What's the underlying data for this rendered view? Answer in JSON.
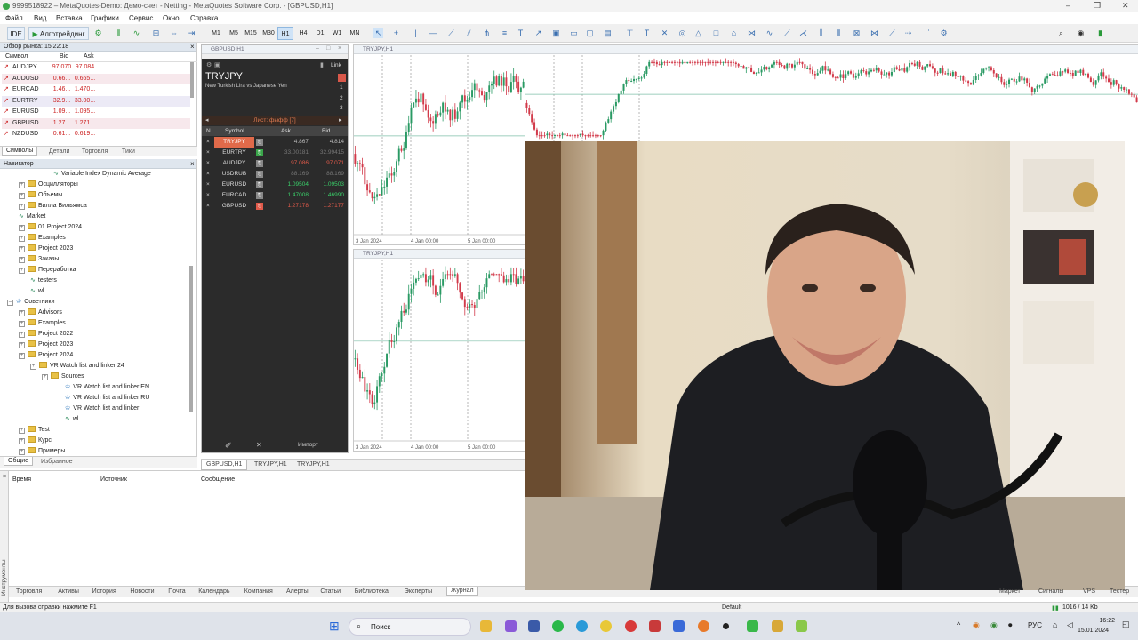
{
  "window": {
    "title": "9999518922 – MetaQuotes-Demo: Демо-счет - Netting - MetaQuotes Software Corp. - [GBPUSD,H1]"
  },
  "menu": [
    "Файл",
    "Вид",
    "Вставка",
    "Графики",
    "Сервис",
    "Окно",
    "Справка"
  ],
  "toolbar": {
    "ide": "IDE",
    "algo": "Алготрейдинг",
    "timeframes": [
      "M1",
      "M5",
      "M15",
      "M30",
      "H1",
      "H4",
      "D1",
      "W1",
      "MN"
    ],
    "active_tf": "H1"
  },
  "market_watch": {
    "header": "Обзор рынка: 15:22:18",
    "columns": [
      "Символ",
      "Bid",
      "Ask"
    ],
    "rows": [
      {
        "symbol": "AUDJPY",
        "bid": "97.070",
        "ask": "97.084"
      },
      {
        "symbol": "AUDUSD",
        "bid": "0.66...",
        "ask": "0.665..."
      },
      {
        "symbol": "EURCAD",
        "bid": "1.46...",
        "ask": "1.470..."
      },
      {
        "symbol": "EURTRY",
        "bid": "32.9...",
        "ask": "33.00..."
      },
      {
        "symbol": "EURUSD",
        "bid": "1.09...",
        "ask": "1.095..."
      },
      {
        "symbol": "GBPUSD",
        "bid": "1.27...",
        "ask": "1.271..."
      },
      {
        "symbol": "NZDUSD",
        "bid": "0.61...",
        "ask": "0.619..."
      }
    ],
    "tabs": [
      "Символы",
      "Детали",
      "Торговля",
      "Тики"
    ]
  },
  "navigator": {
    "header": "Навигатор",
    "items": [
      {
        "label": "Variable Index Dynamic Average",
        "type": "script"
      },
      {
        "label": "Осцилляторы",
        "type": "folder"
      },
      {
        "label": "Объемы",
        "type": "folder"
      },
      {
        "label": "Билла Вильямса",
        "type": "folder"
      },
      {
        "label": "Market",
        "type": "script"
      },
      {
        "label": "01 Project 2024",
        "type": "folder"
      },
      {
        "label": "Examples",
        "type": "folder"
      },
      {
        "label": "Project 2023",
        "type": "folder"
      },
      {
        "label": "Заказы",
        "type": "folder"
      },
      {
        "label": "Переработка",
        "type": "folder"
      },
      {
        "label": "testers",
        "type": "script"
      },
      {
        "label": "wl",
        "type": "script"
      },
      {
        "label": "Советники",
        "type": "root"
      },
      {
        "label": "Advisors",
        "type": "folder"
      },
      {
        "label": "Examples",
        "type": "folder"
      },
      {
        "label": "Project 2022",
        "type": "folder"
      },
      {
        "label": "Project 2023",
        "type": "folder"
      },
      {
        "label": "Project 2024",
        "type": "folder"
      },
      {
        "label": "VR Watch list and linker 24",
        "type": "folder"
      },
      {
        "label": "Sources",
        "type": "folder"
      },
      {
        "label": "VR Watch list and linker EN",
        "type": "ea"
      },
      {
        "label": "VR Watch list and linker RU",
        "type": "ea"
      },
      {
        "label": "VR Watch list and linker",
        "type": "ea"
      },
      {
        "label": "wl",
        "type": "script"
      },
      {
        "label": "Test",
        "type": "folder"
      },
      {
        "label": "Курс",
        "type": "folder"
      },
      {
        "label": "Примеры",
        "type": "folder"
      }
    ],
    "tabs": [
      "Общие",
      "Избранное"
    ]
  },
  "watchlist": {
    "title": "GBPUSD,H1",
    "link": "Link",
    "symbol": "TRYJPY",
    "description": "New Turkish Lira vs Japanese Yen",
    "numbers": [
      "1",
      "2",
      "3"
    ],
    "list_name": "Лист: фыфф [7]",
    "columns": [
      "N",
      "Symbol",
      "Ask",
      "Bid"
    ],
    "rows": [
      {
        "symbol": "TRYJPY",
        "ask": "4.867",
        "bid": "4.814"
      },
      {
        "symbol": "EURTRY",
        "ask": "33.00181",
        "bid": "32.99415"
      },
      {
        "symbol": "AUDJPY",
        "ask": "97.086",
        "bid": "97.071"
      },
      {
        "symbol": "USDRUB",
        "ask": "88.169",
        "bid": "88.169"
      },
      {
        "symbol": "EURUSD",
        "ask": "1.09504",
        "bid": "1.09503"
      },
      {
        "symbol": "EURCAD",
        "ask": "1.47008",
        "bid": "1.46990"
      },
      {
        "symbol": "GBPUSD",
        "ask": "1.27178",
        "bid": "1.27177"
      }
    ],
    "import": "Импорт"
  },
  "charts": {
    "top": {
      "title": "TRYJPY,H1",
      "xlabels": [
        "3 Jan 2024",
        "4 Jan 00:00",
        "5 Jan 00:00"
      ]
    },
    "bottom": {
      "title": "TRYJPY,H1",
      "xlabels": [
        "3 Jan 2024",
        "4 Jan 00:00",
        "5 Jan 00:00"
      ]
    }
  },
  "chart_tabs": [
    "GBPUSD,H1",
    "TRYJPY,H1",
    "TRYJPY,H1"
  ],
  "journal": {
    "columns": [
      "Время",
      "Источник",
      "Сообщение"
    ],
    "side_label": "Инструменты",
    "tabs": [
      "Торговля",
      "Активы",
      "История",
      "Новости",
      "Почта",
      "Календарь",
      "Компания",
      "Алерты",
      "Статьи",
      "Библиотека",
      "Эксперты",
      "Журнал"
    ],
    "right_tabs": [
      "Маркет",
      "Сигналы",
      "VPS",
      "Тестер"
    ]
  },
  "status": {
    "help": "Для вызова справки нажмите F1",
    "profile": "Default",
    "traffic": "1016 / 14 Kb"
  },
  "taskbar": {
    "search": "Поиск",
    "lang": "РУС",
    "time": "16:22",
    "date": "15.01.2024"
  },
  "colors": {
    "up": "#2a9a64",
    "down": "#d23a4a",
    "accent": "#3a7fc0"
  }
}
